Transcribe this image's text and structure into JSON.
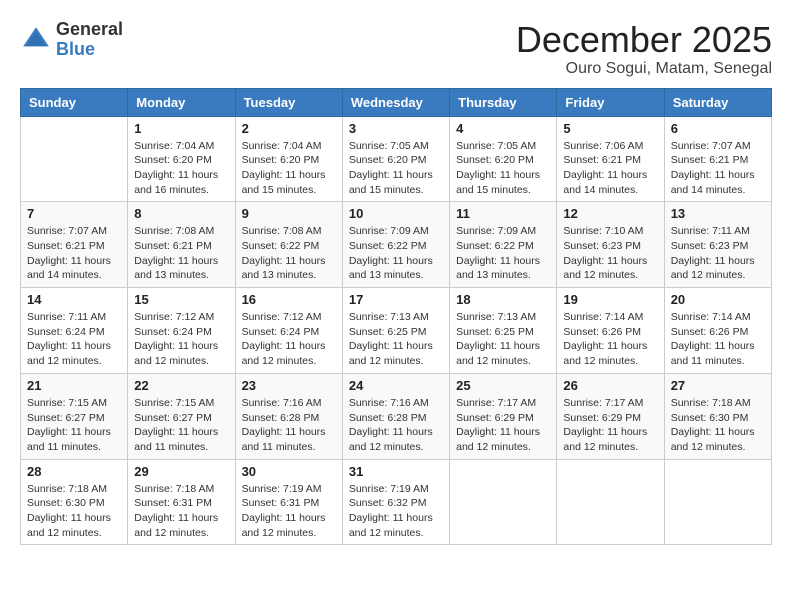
{
  "header": {
    "logo_general": "General",
    "logo_blue": "Blue",
    "month_year": "December 2025",
    "location": "Ouro Sogui, Matam, Senegal"
  },
  "days_of_week": [
    "Sunday",
    "Monday",
    "Tuesday",
    "Wednesday",
    "Thursday",
    "Friday",
    "Saturday"
  ],
  "weeks": [
    [
      {
        "day": "",
        "info": ""
      },
      {
        "day": "1",
        "info": "Sunrise: 7:04 AM\nSunset: 6:20 PM\nDaylight: 11 hours\nand 16 minutes."
      },
      {
        "day": "2",
        "info": "Sunrise: 7:04 AM\nSunset: 6:20 PM\nDaylight: 11 hours\nand 15 minutes."
      },
      {
        "day": "3",
        "info": "Sunrise: 7:05 AM\nSunset: 6:20 PM\nDaylight: 11 hours\nand 15 minutes."
      },
      {
        "day": "4",
        "info": "Sunrise: 7:05 AM\nSunset: 6:20 PM\nDaylight: 11 hours\nand 15 minutes."
      },
      {
        "day": "5",
        "info": "Sunrise: 7:06 AM\nSunset: 6:21 PM\nDaylight: 11 hours\nand 14 minutes."
      },
      {
        "day": "6",
        "info": "Sunrise: 7:07 AM\nSunset: 6:21 PM\nDaylight: 11 hours\nand 14 minutes."
      }
    ],
    [
      {
        "day": "7",
        "info": "Sunrise: 7:07 AM\nSunset: 6:21 PM\nDaylight: 11 hours\nand 14 minutes."
      },
      {
        "day": "8",
        "info": "Sunrise: 7:08 AM\nSunset: 6:21 PM\nDaylight: 11 hours\nand 13 minutes."
      },
      {
        "day": "9",
        "info": "Sunrise: 7:08 AM\nSunset: 6:22 PM\nDaylight: 11 hours\nand 13 minutes."
      },
      {
        "day": "10",
        "info": "Sunrise: 7:09 AM\nSunset: 6:22 PM\nDaylight: 11 hours\nand 13 minutes."
      },
      {
        "day": "11",
        "info": "Sunrise: 7:09 AM\nSunset: 6:22 PM\nDaylight: 11 hours\nand 13 minutes."
      },
      {
        "day": "12",
        "info": "Sunrise: 7:10 AM\nSunset: 6:23 PM\nDaylight: 11 hours\nand 12 minutes."
      },
      {
        "day": "13",
        "info": "Sunrise: 7:11 AM\nSunset: 6:23 PM\nDaylight: 11 hours\nand 12 minutes."
      }
    ],
    [
      {
        "day": "14",
        "info": "Sunrise: 7:11 AM\nSunset: 6:24 PM\nDaylight: 11 hours\nand 12 minutes."
      },
      {
        "day": "15",
        "info": "Sunrise: 7:12 AM\nSunset: 6:24 PM\nDaylight: 11 hours\nand 12 minutes."
      },
      {
        "day": "16",
        "info": "Sunrise: 7:12 AM\nSunset: 6:24 PM\nDaylight: 11 hours\nand 12 minutes."
      },
      {
        "day": "17",
        "info": "Sunrise: 7:13 AM\nSunset: 6:25 PM\nDaylight: 11 hours\nand 12 minutes."
      },
      {
        "day": "18",
        "info": "Sunrise: 7:13 AM\nSunset: 6:25 PM\nDaylight: 11 hours\nand 12 minutes."
      },
      {
        "day": "19",
        "info": "Sunrise: 7:14 AM\nSunset: 6:26 PM\nDaylight: 11 hours\nand 12 minutes."
      },
      {
        "day": "20",
        "info": "Sunrise: 7:14 AM\nSunset: 6:26 PM\nDaylight: 11 hours\nand 11 minutes."
      }
    ],
    [
      {
        "day": "21",
        "info": "Sunrise: 7:15 AM\nSunset: 6:27 PM\nDaylight: 11 hours\nand 11 minutes."
      },
      {
        "day": "22",
        "info": "Sunrise: 7:15 AM\nSunset: 6:27 PM\nDaylight: 11 hours\nand 11 minutes."
      },
      {
        "day": "23",
        "info": "Sunrise: 7:16 AM\nSunset: 6:28 PM\nDaylight: 11 hours\nand 11 minutes."
      },
      {
        "day": "24",
        "info": "Sunrise: 7:16 AM\nSunset: 6:28 PM\nDaylight: 11 hours\nand 12 minutes."
      },
      {
        "day": "25",
        "info": "Sunrise: 7:17 AM\nSunset: 6:29 PM\nDaylight: 11 hours\nand 12 minutes."
      },
      {
        "day": "26",
        "info": "Sunrise: 7:17 AM\nSunset: 6:29 PM\nDaylight: 11 hours\nand 12 minutes."
      },
      {
        "day": "27",
        "info": "Sunrise: 7:18 AM\nSunset: 6:30 PM\nDaylight: 11 hours\nand 12 minutes."
      }
    ],
    [
      {
        "day": "28",
        "info": "Sunrise: 7:18 AM\nSunset: 6:30 PM\nDaylight: 11 hours\nand 12 minutes."
      },
      {
        "day": "29",
        "info": "Sunrise: 7:18 AM\nSunset: 6:31 PM\nDaylight: 11 hours\nand 12 minutes."
      },
      {
        "day": "30",
        "info": "Sunrise: 7:19 AM\nSunset: 6:31 PM\nDaylight: 11 hours\nand 12 minutes."
      },
      {
        "day": "31",
        "info": "Sunrise: 7:19 AM\nSunset: 6:32 PM\nDaylight: 11 hours\nand 12 minutes."
      },
      {
        "day": "",
        "info": ""
      },
      {
        "day": "",
        "info": ""
      },
      {
        "day": "",
        "info": ""
      }
    ]
  ]
}
